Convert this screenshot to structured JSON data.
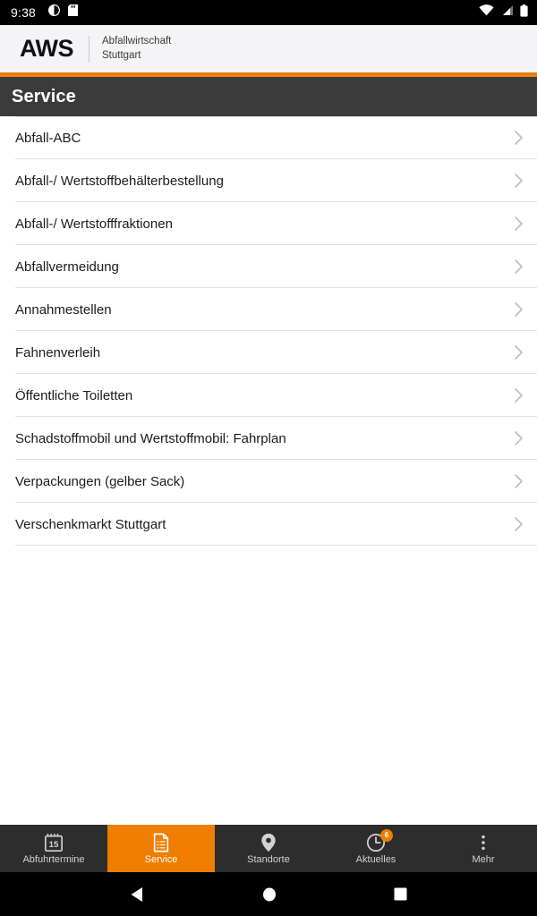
{
  "status_bar": {
    "time": "9:38",
    "left_icons": [
      "notification-circle-icon",
      "sd-card-icon"
    ],
    "right_icons": [
      "wifi-icon",
      "cellular-signal-icon",
      "battery-icon"
    ]
  },
  "brand_header": {
    "logo_text": "AWS",
    "subtitle_line1": "Abfallwirtschaft",
    "subtitle_line2": "Stuttgart",
    "accent_color": "#ef7d00"
  },
  "title_bar": {
    "title": "Service",
    "background": "#3b3b3b"
  },
  "service_list": {
    "chevron_icon": "chevron-right-icon",
    "items": [
      {
        "label": "Abfall-ABC"
      },
      {
        "label": "Abfall-/ Wertstoffbehälterbestellung"
      },
      {
        "label": "Abfall-/ Wertstofffraktionen"
      },
      {
        "label": "Abfallvermeidung"
      },
      {
        "label": "Annahmestellen"
      },
      {
        "label": "Fahnenverleih"
      },
      {
        "label": "Öffentliche Toiletten"
      },
      {
        "label": "Schadstoffmobil und Wertstoffmobil: Fahrplan"
      },
      {
        "label": "Verpackungen (gelber Sack)"
      },
      {
        "label": "Verschenkmarkt Stuttgart"
      }
    ]
  },
  "tab_bar": {
    "active_color": "#ef7d00",
    "background": "#2d2d2d",
    "tabs": [
      {
        "label": "Abfuhrtermine",
        "icon": "calendar-icon",
        "calendar_day": "15",
        "active": false,
        "badge": ""
      },
      {
        "label": "Service",
        "icon": "document-list-icon",
        "active": true,
        "badge": ""
      },
      {
        "label": "Standorte",
        "icon": "map-pin-icon",
        "active": false,
        "badge": ""
      },
      {
        "label": "Aktuelles",
        "icon": "clock-icon",
        "active": false,
        "badge": "6"
      },
      {
        "label": "Mehr",
        "icon": "more-vertical-icon",
        "active": false,
        "badge": ""
      }
    ]
  },
  "android_nav": {
    "back": "back-triangle-icon",
    "home": "home-circle-icon",
    "recents": "recents-square-icon"
  }
}
